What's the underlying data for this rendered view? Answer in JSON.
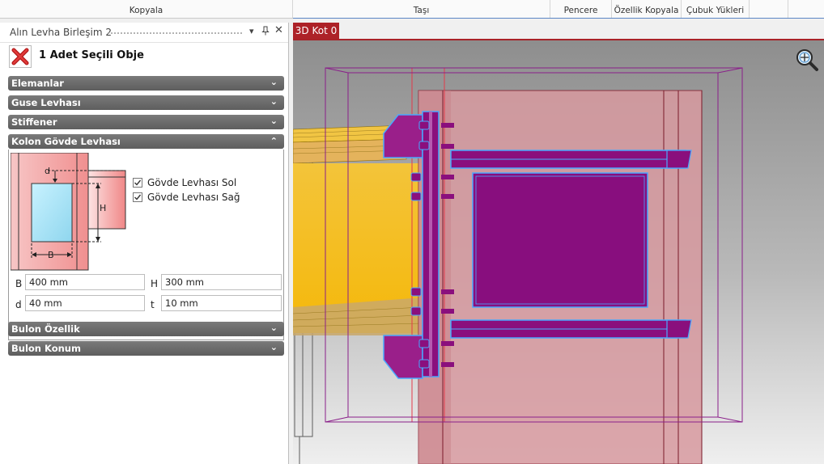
{
  "toolbar": {
    "groups": [
      "Kopyala",
      "Taşı",
      "Pencere",
      "Özellik Kopyala",
      "Çubuk Yükleri"
    ]
  },
  "panel": {
    "title": "Alın Levha Birleşim 2",
    "pin_icon": "pin-icon",
    "dropdown_icon": "chevron-down-icon",
    "close_icon": "close-icon",
    "selection_text": "1 Adet Seçili Obje",
    "selection_icon": "red-x-icon",
    "sections": [
      {
        "label": "Elemanlar",
        "expanded": false
      },
      {
        "label": "Guse Levhası",
        "expanded": false
      },
      {
        "label": "Stiffener",
        "expanded": false
      },
      {
        "label": "Kolon Gövde Levhası",
        "expanded": true
      },
      {
        "label": "Bulon Özellik",
        "expanded": false
      },
      {
        "label": "Bulon Konum",
        "expanded": false
      }
    ],
    "checkboxes": [
      {
        "label": "Gövde Levhası Sol",
        "checked": true
      },
      {
        "label": "Gövde Levhası Sağ",
        "checked": true
      }
    ],
    "diagram_labels": {
      "d": "d",
      "h": "H",
      "b": "B"
    },
    "fields": {
      "B": {
        "label": "B",
        "value": "400 mm"
      },
      "H": {
        "label": "H",
        "value": "300 mm"
      },
      "d": {
        "label": "d",
        "value": "40 mm"
      },
      "t": {
        "label": "t",
        "value": "10 mm"
      }
    }
  },
  "viewport": {
    "tab_label": "3D Kot 0",
    "zoom_icon": "magnifier-icon"
  },
  "colors": {
    "accent_red": "#ad2228",
    "section_header": "#6b6b6b",
    "beam_yellow": "#f5b90c",
    "plate_purple": "#8a0f7d",
    "outline_blue": "#4aa8ff",
    "column_pink": "#d79aa0"
  }
}
